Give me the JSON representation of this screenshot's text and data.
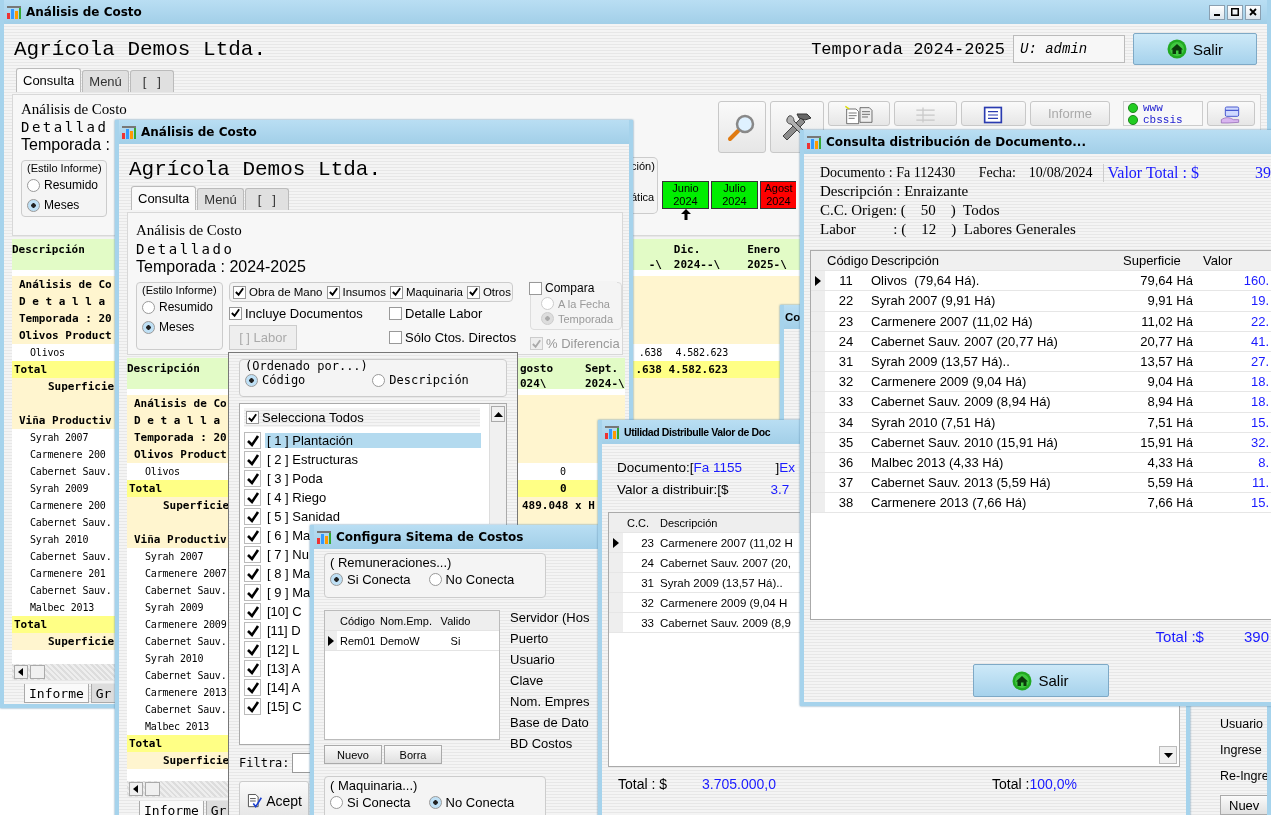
{
  "main_window": {
    "title": "Análisis de Costo",
    "company": "Agrícola Demos Ltda.",
    "season": "Temporada 2024-2025",
    "user": "U: admin",
    "exit_button": "Salir",
    "tabs": [
      {
        "label": "Consulta",
        "selected": true
      },
      {
        "label": "Menú",
        "selected": false
      },
      {
        "label": "[   ]",
        "selected": false
      }
    ],
    "report_heading": {
      "title": "Análisis de Costo",
      "subtitle": "Detallad",
      "season": "Temporada :"
    },
    "report_style": {
      "legend": "(Estilo Informe)",
      "options": [
        {
          "label": "Resumido",
          "selected": false
        },
        {
          "label": "Meses",
          "selected": true
        }
      ]
    },
    "toolbar": [
      {
        "kind": "search"
      },
      {
        "kind": "tools"
      },
      {
        "kind": "documents"
      },
      {
        "kind": "table"
      },
      {
        "kind": "list"
      },
      {
        "kind": "text",
        "label": "Informe"
      },
      {
        "kind": "status",
        "lines": [
          "www",
          "cbssis"
        ]
      },
      {
        "kind": "card"
      }
    ],
    "partial_group": {
      "legend": "ción)",
      "option": "ática"
    },
    "months": [
      {
        "label": "Junio",
        "year": "2024",
        "color": "#00ee00",
        "current": true
      },
      {
        "label": "Julio",
        "year": "2024",
        "color": "#00ee00",
        "current": false
      },
      {
        "label": "Agost",
        "year": "2024",
        "color": "#ff0000",
        "current": false
      }
    ],
    "table": {
      "columns": [
        [
          "Descripción"
        ],
        [
          "-\\"
        ],
        [
          "Dic.",
          "2024--\\"
        ],
        [
          "Enero",
          "2025-\\"
        ]
      ],
      "rows": [
        {
          "kind": "title",
          "cells": [
            "Análisis de Co"
          ]
        },
        {
          "kind": "title",
          "cells": [
            "D e t a l l a"
          ]
        },
        {
          "kind": "title",
          "cells": [
            "Temporada : 20"
          ]
        },
        {
          "kind": "group",
          "cells": [
            "Olivos Product"
          ]
        },
        {
          "kind": "item",
          "cells": [
            "Olivos",
            ".638",
            "4.582.623"
          ]
        },
        {
          "kind": "total",
          "cells": [
            "Total",
            ".638",
            "4.582.623"
          ]
        },
        {
          "kind": "area",
          "cells": [
            "Superficie"
          ]
        },
        {
          "kind": "blank"
        },
        {
          "kind": "group",
          "cells": [
            "Viña Productiv"
          ]
        },
        {
          "kind": "item",
          "cells": [
            "Syrah 2007"
          ]
        },
        {
          "kind": "item",
          "cells": [
            "Carmenere 200"
          ]
        },
        {
          "kind": "item",
          "cells": [
            "Cabernet Sauv."
          ]
        },
        {
          "kind": "item",
          "cells": [
            "Syrah 2009"
          ]
        },
        {
          "kind": "item",
          "cells": [
            "Carmenere 200"
          ]
        },
        {
          "kind": "item",
          "cells": [
            "Cabernet Sauv."
          ]
        },
        {
          "kind": "item",
          "cells": [
            "Syrah 2010"
          ]
        },
        {
          "kind": "item",
          "cells": [
            "Cabernet Sauv."
          ]
        },
        {
          "kind": "item",
          "cells": [
            "Carmenere 201"
          ]
        },
        {
          "kind": "item",
          "cells": [
            "Cabernet Sauv."
          ]
        },
        {
          "kind": "item",
          "cells": [
            "Malbec 2013"
          ]
        },
        {
          "kind": "total",
          "cells": [
            "Total"
          ]
        },
        {
          "kind": "area",
          "cells": [
            "Superficie"
          ]
        }
      ]
    },
    "bottom_tabs": [
      {
        "label": "Informe",
        "selected": true
      },
      {
        "label": "Gr",
        "selected": false
      }
    ]
  },
  "second_window": {
    "title": "Análisis de Costo",
    "company": "Agrícola Demos Ltda.",
    "tabs": [
      {
        "label": "Consulta",
        "selected": true
      },
      {
        "label": "Menú",
        "selected": false
      },
      {
        "label": "[   ]",
        "selected": false
      }
    ],
    "report_heading": {
      "title": "Análisis de Costo",
      "subtitle": "Detallado",
      "season": "Temporada : 2024-2025"
    },
    "report_style": {
      "legend": "(Estilo Informe)",
      "options": [
        {
          "label": "Resumido",
          "selected": false
        },
        {
          "label": "Meses",
          "selected": true
        }
      ]
    },
    "cost_types": [
      {
        "label": "Obra de Mano",
        "checked": true
      },
      {
        "label": "Insumos",
        "checked": true
      },
      {
        "label": "Maquinaria",
        "checked": true
      },
      {
        "label": "Otros",
        "checked": true
      }
    ],
    "options": [
      {
        "label": "Incluye Documentos",
        "checked": true
      },
      {
        "label": "Detalle Labor",
        "checked": false
      },
      {
        "label": "Sólo Ctos. Directos",
        "checked": false
      }
    ],
    "labor_button": {
      "label": "[ ] Labor",
      "disabled": true
    },
    "compare": {
      "label": "Compara",
      "checked": false,
      "disabled": true,
      "options": [
        {
          "label": "A la Fecha",
          "selected": false
        },
        {
          "label": "Temporada",
          "selected": true
        }
      ]
    },
    "difference": {
      "label": "% Diferencia",
      "checked": true,
      "disabled": true
    },
    "table": {
      "columns": [
        [
          "Descripción"
        ],
        [
          "gosto",
          "024\\"
        ],
        [
          "Sept.",
          "2024-\\"
        ]
      ],
      "rows": [
        {
          "kind": "title",
          "cells": [
            "Análisis de Co"
          ]
        },
        {
          "kind": "title",
          "cells": [
            "D e t a l l a"
          ]
        },
        {
          "kind": "title",
          "cells": [
            "Temporada : 20"
          ]
        },
        {
          "kind": "group",
          "cells": [
            "Olivos Product"
          ]
        },
        {
          "kind": "item",
          "cells": [
            "Olivos",
            "0"
          ]
        },
        {
          "kind": "total",
          "cells": [
            "Total",
            "0"
          ]
        },
        {
          "kind": "area",
          "cells": [
            "Superficie",
            "489.048 x H"
          ]
        },
        {
          "kind": "blank"
        },
        {
          "kind": "group",
          "cells": [
            "Viña Productiv"
          ]
        },
        {
          "kind": "item",
          "cells": [
            "Syrah 2007"
          ]
        },
        {
          "kind": "item",
          "cells": [
            "Carmenere 2007"
          ]
        },
        {
          "kind": "item",
          "cells": [
            "Cabernet Sauv."
          ]
        },
        {
          "kind": "item",
          "cells": [
            "Syrah 2009"
          ]
        },
        {
          "kind": "item",
          "cells": [
            "Carmenere 2009"
          ]
        },
        {
          "kind": "item",
          "cells": [
            "Cabernet Sauv."
          ]
        },
        {
          "kind": "item",
          "cells": [
            "Syrah 2010"
          ]
        },
        {
          "kind": "item",
          "cells": [
            "Cabernet Sauv."
          ]
        },
        {
          "kind": "item",
          "cells": [
            "Carmenere 2013"
          ]
        },
        {
          "kind": "item",
          "cells": [
            "Cabernet Sauv."
          ]
        },
        {
          "kind": "item",
          "cells": [
            "Malbec 2013"
          ]
        },
        {
          "kind": "total",
          "cells": [
            "Total"
          ]
        },
        {
          "kind": "area",
          "cells": [
            "Superficie"
          ]
        }
      ]
    },
    "bottom_tabs": [
      {
        "label": "Informe",
        "selected": true
      },
      {
        "label": "Gr",
        "selected": false
      }
    ]
  },
  "labor_picker": {
    "order_legend": "(Ordenado por...)",
    "order_options": [
      {
        "label": "Código",
        "selected": true
      },
      {
        "label": "Descripción",
        "selected": false
      }
    ],
    "select_all": {
      "label": "Selecciona Todos",
      "checked": true
    },
    "items": [
      {
        "label": "[ 1 ] Plantación",
        "checked": true,
        "selected": true
      },
      {
        "label": "[ 2 ] Estructuras",
        "checked": true,
        "selected": false
      },
      {
        "label": "[ 3 ] Poda",
        "checked": true,
        "selected": false
      },
      {
        "label": "[ 4 ] Riego",
        "checked": true,
        "selected": false
      },
      {
        "label": "[ 5 ] Sanidad",
        "checked": true,
        "selected": false
      },
      {
        "label": "[ 6 ] Ma",
        "checked": true,
        "selected": false
      },
      {
        "label": "[ 7 ] Nu",
        "checked": true,
        "selected": false
      },
      {
        "label": "[ 8 ] Ma",
        "checked": true,
        "selected": false
      },
      {
        "label": "[ 9 ] Ma",
        "checked": true,
        "selected": false
      },
      {
        "label": "[10] C",
        "checked": true,
        "selected": false
      },
      {
        "label": "[11] D",
        "checked": true,
        "selected": false
      },
      {
        "label": "[12] L",
        "checked": true,
        "selected": false
      },
      {
        "label": "[13] A",
        "checked": true,
        "selected": false
      },
      {
        "label": "[14] A",
        "checked": true,
        "selected": false
      },
      {
        "label": "[15] C",
        "checked": true,
        "selected": false
      }
    ],
    "filter_label": "Filtra:",
    "accept_button": "Acept"
  },
  "config_window": {
    "title": "Configura Sitema de Costos",
    "payroll": {
      "legend": "( Remuneraciones...)",
      "options": [
        {
          "label": "Si Conecta",
          "selected": true
        },
        {
          "label": "No Conecta",
          "selected": false
        }
      ]
    },
    "grid": {
      "columns": [
        "Código",
        "Nom.Emp.",
        "Valido"
      ],
      "rows": [
        {
          "cells": [
            "Rem01",
            "DemoW",
            "Si"
          ],
          "current": true
        }
      ]
    },
    "buttons": [
      "Nuevo",
      "Borra"
    ],
    "fields": [
      "Servidor (Hos",
      "Puerto",
      "Usuario",
      "Clave",
      "Nom. Empres",
      "Base de Dato",
      "BD Costos"
    ],
    "machinery": {
      "legend": "( Maquinaria...)",
      "options": [
        {
          "label": "Si Conecta",
          "selected": false
        },
        {
          "label": "No Conecta",
          "selected": true
        }
      ]
    }
  },
  "background_window": {
    "title": "Co",
    "labels": [
      "Usuario",
      "Ingrese",
      "Re-Ingre"
    ],
    "button": "Nuev"
  },
  "distribution_tool": {
    "title": "Utilidad Distribulle Valor de Doc",
    "document_label": "Documento:[",
    "document": "Fa 1155",
    "document_close": "]",
    "document_tail": "Ex",
    "value_label": "Valor a distribuir:[$",
    "value": "3.7",
    "grid": {
      "columns": [
        "C.C.",
        "Descripción"
      ],
      "rows": [
        {
          "cells": [
            "23",
            "Carmenere 2007 (11,02 H"
          ],
          "current": true
        },
        {
          "cells": [
            "24",
            "Cabernet Sauv. 2007 (20,"
          ],
          "current": false
        },
        {
          "cells": [
            "31",
            "Syrah 2009 (13,57 Há).."
          ],
          "current": false
        },
        {
          "cells": [
            "32",
            "Carmenere 2009 (9,04 H"
          ],
          "current": false
        },
        {
          "cells": [
            "33",
            "Cabernet Sauv. 2009 (8,9"
          ],
          "current": false
        }
      ]
    },
    "total_label": "Total : $",
    "total": "3.705.000,0",
    "percent_label": "Total :",
    "percent": "100,0%"
  },
  "document_window": {
    "title": "Consulta distribución de Documento...",
    "document": "Documento : Fa 112430",
    "date_label": "Fecha:",
    "date": "10/08/2024",
    "total_label": "Valor Total : $",
    "total": "39",
    "lines": [
      "Descripción : Enraizante",
      "C.C. Origen: (    50    )  Todos",
      "Labor          : (    12    )  Labores Generales"
    ],
    "grid": {
      "columns": [
        "Código",
        "Descripción",
        "Superficie",
        "Valor"
      ],
      "rows": [
        {
          "cells": [
            "11",
            "Olivos  (79,64 Há).",
            "79,64 Há",
            "160."
          ],
          "current": true
        },
        {
          "cells": [
            "22",
            "Syrah 2007 (9,91 Há)",
            "9,91 Há",
            "19."
          ],
          "current": false
        },
        {
          "cells": [
            "23",
            "Carmenere 2007 (11,02 Há)",
            "11,02 Há",
            "22."
          ],
          "current": false
        },
        {
          "cells": [
            "24",
            "Cabernet Sauv. 2007 (20,77 Há)",
            "20,77 Há",
            "41."
          ],
          "current": false
        },
        {
          "cells": [
            "31",
            "Syrah 2009 (13,57 Há)..",
            "13,57 Há",
            "27."
          ],
          "current": false
        },
        {
          "cells": [
            "32",
            "Carmenere 2009 (9,04 Há)",
            "9,04 Há",
            "18."
          ],
          "current": false
        },
        {
          "cells": [
            "33",
            "Cabernet Sauv. 2009 (8,94 Há)",
            "8,94 Há",
            "18."
          ],
          "current": false
        },
        {
          "cells": [
            "34",
            "Syrah 2010 (7,51 Há)",
            "7,51 Há",
            "15."
          ],
          "current": false
        },
        {
          "cells": [
            "35",
            "Cabernet Sauv. 2010 (15,91 Há)",
            "15,91 Há",
            "32."
          ],
          "current": false
        },
        {
          "cells": [
            "36",
            "Malbec 2013 (4,33 Há)",
            "4,33 Há",
            "8."
          ],
          "current": false
        },
        {
          "cells": [
            "37",
            "Cabernet Sauv. 2013 (5,59 Há)",
            "5,59 Há",
            "11."
          ],
          "current": false
        },
        {
          "cells": [
            "38",
            "Carmenere 2013 (7,66 Há)",
            "7,66 Há",
            "15."
          ],
          "current": false
        }
      ]
    },
    "footer_label": "Total :$",
    "footer_total": "390",
    "exit_button": "Salir"
  }
}
